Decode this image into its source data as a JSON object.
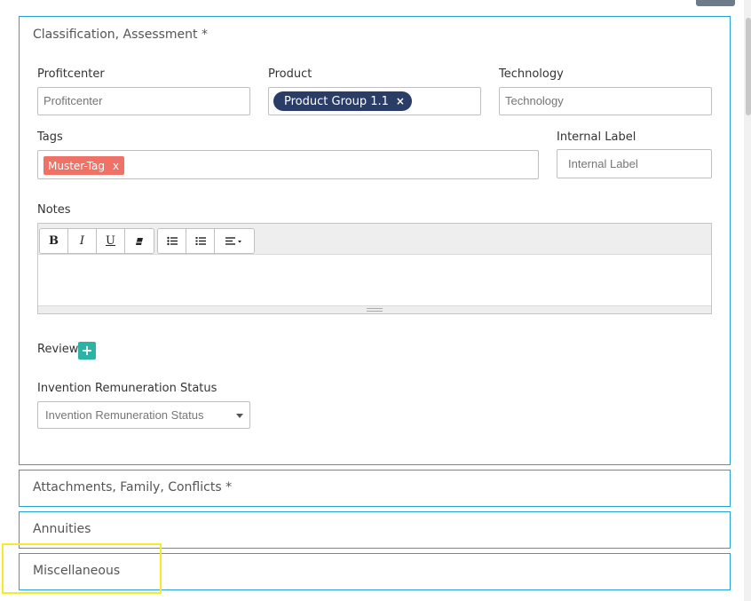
{
  "colors": {
    "panel_border": "#27a2d4",
    "pill_bg": "#2a3d66",
    "tag_bg": "#f07266",
    "add_button": "#2bb3a6",
    "highlight": "#f3ec2b"
  },
  "sections": {
    "classification": {
      "title": "Classification, Assessment *",
      "profitcenter": {
        "label": "Profitcenter",
        "placeholder": "Profitcenter"
      },
      "product": {
        "label": "Product",
        "selected": "Product Group 1.1",
        "remove": "×"
      },
      "technology": {
        "label": "Technology",
        "placeholder": "Technology"
      },
      "tags": {
        "label": "Tags",
        "items": [
          {
            "text": "Muster-Tag",
            "remove": "x"
          }
        ]
      },
      "internal_label": {
        "label": "Internal Label",
        "placeholder": "Internal Label"
      },
      "notes": {
        "label": "Notes",
        "toolbar": {
          "bold": "B",
          "italic": "I",
          "underline": "U",
          "icons": [
            "eraser-icon",
            "unordered-list-icon",
            "ordered-list-icon",
            "align-icon"
          ]
        }
      },
      "review": {
        "label": "Review",
        "add": "+"
      },
      "remuneration": {
        "label": "Invention Remuneration Status",
        "placeholder": "Invention Remuneration Status"
      }
    },
    "attachments": {
      "title": "Attachments, Family, Conflicts *"
    },
    "annuities": {
      "title": "Annuities"
    },
    "miscellaneous": {
      "title": "Miscellaneous"
    }
  }
}
